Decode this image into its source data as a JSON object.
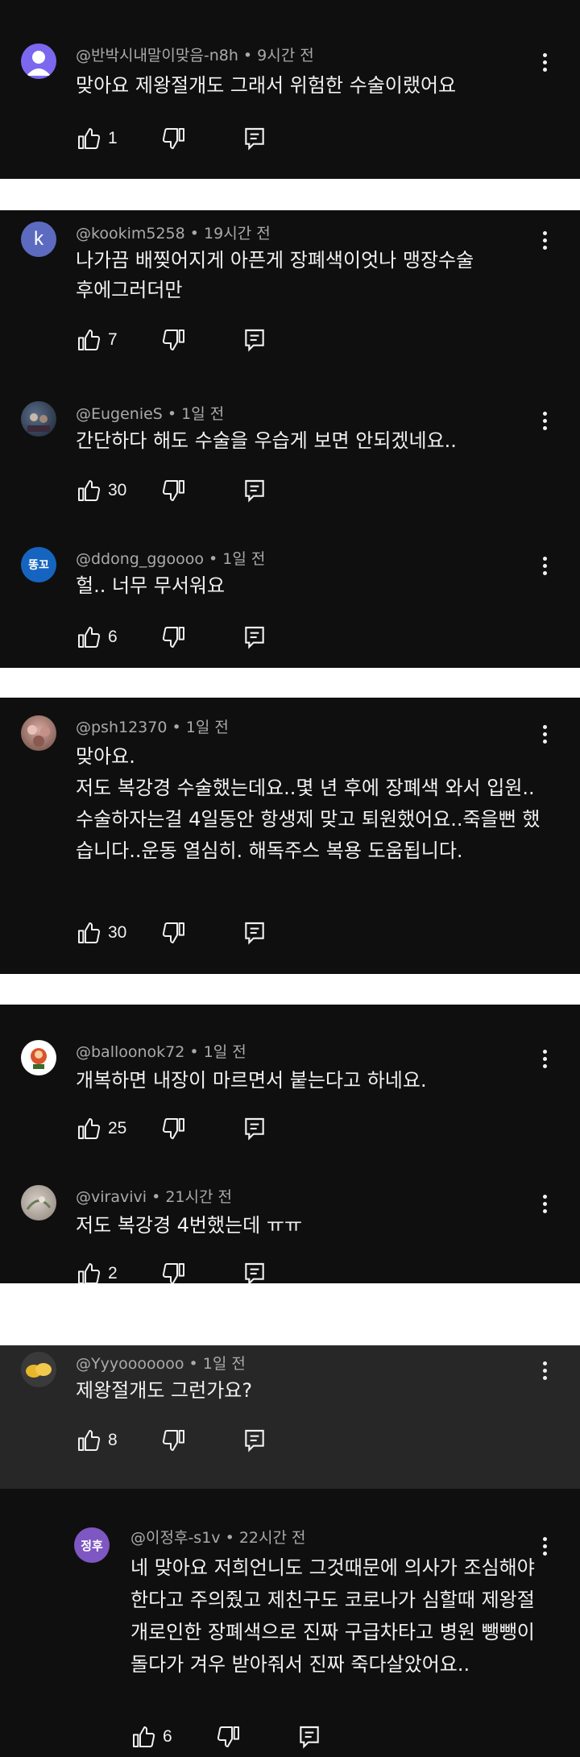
{
  "comments": [
    {
      "handle": "@반박시내말이맞음-n8h",
      "time": "9시간 전",
      "text": "맞아요 제왕절개도 그래서 위험한 수술이랬어요",
      "likes": "1",
      "avatar": {
        "letter": "",
        "color": "#7b68ee"
      }
    },
    {
      "handle": "@kookim5258",
      "time": "19시간 전",
      "text": "나가끔 배찢어지게 아픈게  장폐색이엇나 맹장수술후에그러더만",
      "likes": "7",
      "avatar": {
        "letter": "k",
        "color": "#5c6bc0"
      }
    },
    {
      "handle": "@EugenieS",
      "time": "1일 전",
      "text": "간단하다 해도 수술을 우습게 보면 안되겠네요..",
      "likes": "30",
      "avatar": {
        "letter": "",
        "color": "#2b3a4a"
      }
    },
    {
      "handle": "@ddong_ggoooo",
      "time": "1일 전",
      "text": "헐.. 너무 무서워요",
      "likes": "6",
      "avatar": {
        "letter": "똥꼬",
        "color": "#1565c0"
      }
    },
    {
      "handle": "@psh12370",
      "time": "1일 전",
      "text": "맞아요.\n저도 복강경 수술했는데요..몇 년 후에 장폐색 와서 입원..수술하자는걸 4일동안 항생제 맞고 퇴원했어요..죽을뻔 했습니다..운동 열심히. 해독주스 복용 도움됩니다.",
      "likes": "30",
      "avatar": {
        "letter": "",
        "color": "#8a6a5a"
      }
    },
    {
      "handle": "@balloonok72",
      "time": "1일 전",
      "text": "개복하면 내장이 마르면서 붙는다고 하네요.",
      "likes": "25",
      "avatar": {
        "letter": "",
        "color": "#ffffff"
      }
    },
    {
      "handle": "@viravivi",
      "time": "21시간 전",
      "text": "저도 복강경 4번했는데 ㅠㅠ",
      "likes": "2",
      "avatar": {
        "letter": "",
        "color": "#b0a8a0"
      }
    },
    {
      "handle": "@Yyyooooooo",
      "time": "1일 전",
      "text": "제왕절개도 그런가요?",
      "likes": "8",
      "avatar": {
        "letter": "",
        "color": "#d9a520"
      }
    },
    {
      "handle": "@이정후-s1v",
      "time": "22시간 전",
      "text": "네 맞아요 저희언니도 그것때문에 의사가 조심해야한다고 주의줬고 제친구도  코로나가 심할때 제왕절개로인한 장폐색으로 진짜 구급차타고 병원 뺑뺑이 돌다가 겨우 받아줘서 진짜 죽다살았어요..",
      "likes": "6",
      "avatar": {
        "letter": "정후",
        "color": "#7e57c2"
      }
    }
  ],
  "icons": {
    "like": "thumbs-up-icon",
    "dislike": "thumbs-down-icon",
    "reply": "reply-icon",
    "more": "more-vertical-icon"
  },
  "colors": {
    "panel": "#0f0f0f",
    "highlight": "#272727",
    "text": "#f1f1f1",
    "meta": "#aaaaaa",
    "gap": "#ffffff"
  }
}
